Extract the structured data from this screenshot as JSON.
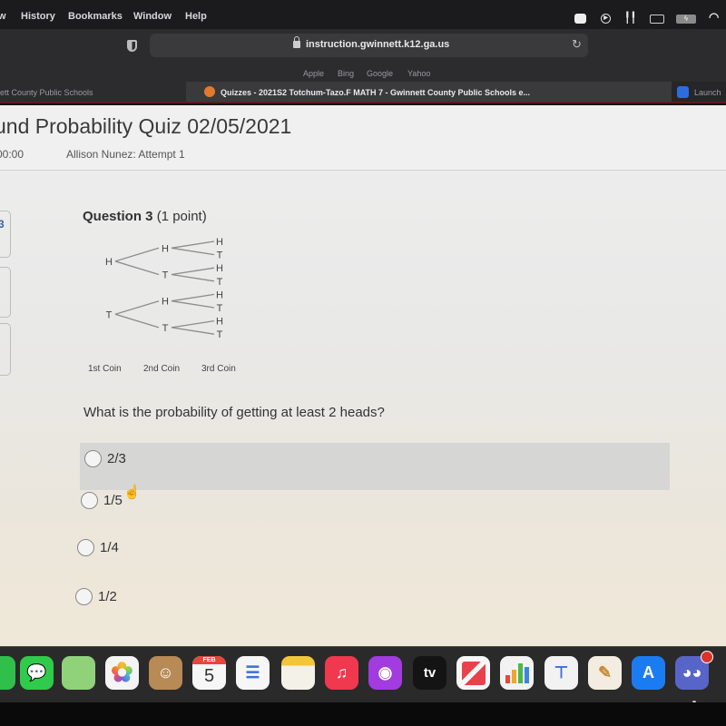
{
  "menubar": {
    "items": [
      "w",
      "History",
      "Bookmarks",
      "Window",
      "Help"
    ],
    "status_icons": [
      "zoom-icon",
      "play-icon",
      "airpods-icon",
      "display-icon",
      "battery-icon",
      "wifi-icon"
    ]
  },
  "browser": {
    "url": "instruction.gwinnett.k12.ga.us",
    "favorites": [
      "Apple",
      "Bing",
      "Google",
      "Yahoo"
    ],
    "tabs": [
      {
        "label": "ett County Public Schools",
        "active": false
      },
      {
        "label": "Quizzes - 2021S2 Totchum-Tazo.F MATH 7 - Gwinnett County Public Schools e...",
        "active": true
      },
      {
        "label": "Launch",
        "active": false
      }
    ]
  },
  "quiz": {
    "title": "und Probability Quiz 02/05/2021",
    "timer": "00:00",
    "attempt": "Allison Nunez: Attempt 1",
    "side_number": "3"
  },
  "question": {
    "number_label": "Question 3",
    "points": "(1 point)",
    "text": "What is the probability of getting at least 2 heads?",
    "tree": {
      "first": [
        "H",
        "T"
      ],
      "second": [
        "H",
        "T",
        "H",
        "T"
      ],
      "third": [
        "H",
        "T",
        "H",
        "T",
        "H",
        "T",
        "H",
        "T"
      ],
      "labels": [
        "1st Coin",
        "2nd Coin",
        "3rd Coin"
      ]
    },
    "options": [
      {
        "label": "2/3",
        "selected": false,
        "hovered": true
      },
      {
        "label": "1/5",
        "selected": false,
        "hovered": false
      },
      {
        "label": "1/4",
        "selected": false,
        "hovered": false
      },
      {
        "label": "1/2",
        "selected": false,
        "hovered": false
      }
    ]
  },
  "dock": {
    "apps": [
      {
        "name": "facetime",
        "glyph": "",
        "color": "#2fbf4a"
      },
      {
        "name": "messages",
        "glyph": "💬",
        "color": "#2fcb4a"
      },
      {
        "name": "maps",
        "glyph": "",
        "color": "#8fd27a"
      },
      {
        "name": "photos",
        "glyph": "✿",
        "color": "#f4f4f4"
      },
      {
        "name": "contacts",
        "glyph": "☺",
        "color": "#b88a55"
      },
      {
        "name": "calendar",
        "glyph": "5",
        "month": "FEB",
        "color": "#f6f6f6"
      },
      {
        "name": "reminders",
        "glyph": "☰",
        "color": "#f6f6f6"
      },
      {
        "name": "notes",
        "glyph": "",
        "color": "#f3e7b0"
      },
      {
        "name": "music",
        "glyph": "♫",
        "color": "#f0384e"
      },
      {
        "name": "podcasts",
        "glyph": "◉",
        "color": "#a23be0"
      },
      {
        "name": "apple-tv",
        "glyph": "tv",
        "color": "#141414"
      },
      {
        "name": "news",
        "glyph": "N",
        "color": "#f6f6f6"
      },
      {
        "name": "numbers",
        "glyph": "▮",
        "color": "#f2f2f2"
      },
      {
        "name": "keynote",
        "glyph": "⊤",
        "color": "#f2f2f2"
      },
      {
        "name": "pages",
        "glyph": "✎",
        "color": "#f2ede0"
      },
      {
        "name": "app-store",
        "glyph": "A",
        "color": "#1b7cf2"
      },
      {
        "name": "discord",
        "glyph": "◕◕",
        "color": "#5865c8",
        "badge": true
      }
    ]
  }
}
